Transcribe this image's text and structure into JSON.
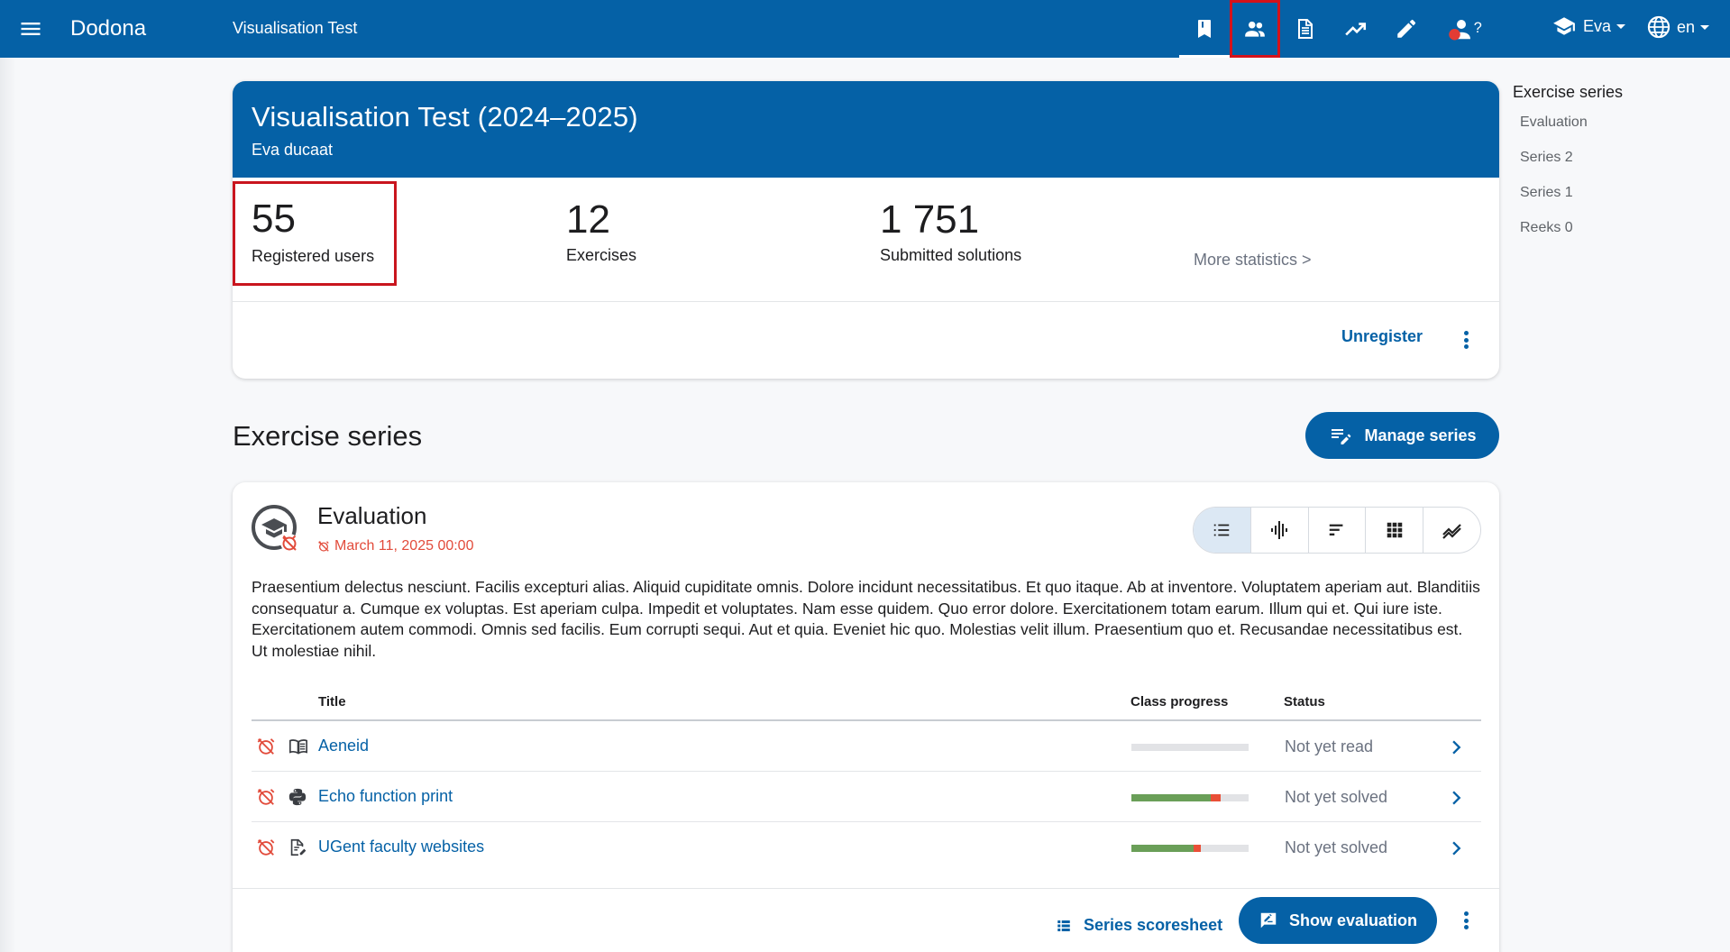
{
  "topbar": {
    "brand": "Dodona",
    "course_name": "Visualisation Test",
    "nav_icons": [
      "bookmark-icon",
      "users-icon",
      "file-document-icon",
      "trending-up-icon",
      "pencil-icon",
      "account-question-icon"
    ],
    "user_label": "Eva",
    "lang_label": "en",
    "highlight_color": "#d4121a"
  },
  "course": {
    "title": "Visualisation Test (2024–2025)",
    "teacher": "Eva ducaat",
    "stats": {
      "users_num": "55",
      "users_label": "Registered users",
      "exercises_num": "12",
      "exercises_label": "Exercises",
      "solutions_num": "1 751",
      "solutions_label": "Submitted solutions",
      "more": "More statistics >"
    },
    "unregister": "Unregister"
  },
  "toc": {
    "title": "Exercise series",
    "items": [
      "Evaluation",
      "Series 2",
      "Series 1",
      "Reeks 0"
    ]
  },
  "section": {
    "title": "Exercise series",
    "manage_label": "Manage series"
  },
  "series": {
    "name": "Evaluation",
    "deadline": "March 11, 2025 00:00",
    "description": "Praesentium delectus nesciunt. Facilis excepturi alias. Aliquid cupiditate omnis. Dolore incidunt necessitatibus. Et quo itaque. Ab at inventore. Voluptatem aperiam aut. Blanditiis consequatur a. Cumque ex voluptas. Est aperiam culpa. Impedit et voluptates. Nam esse quidem. Quo error dolore. Exercitationem totam earum. Illum qui et. Qui iure iste. Exercitationem autem commodi. Omnis sed facilis. Eum corrupti sequi. Aut et quia. Eveniet hic quo. Molestias velit illum. Praesentium quo et. Recusandae necessitatibus est. Ut molestiae nihil.",
    "columns": {
      "title": "Title",
      "progress": "Class progress",
      "status": "Status"
    },
    "exercises": [
      {
        "title": "Aeneid",
        "type_icon": "book-open-icon",
        "status": "Not yet read",
        "progress_solved": 0,
        "progress_wrong": 0
      },
      {
        "title": "Echo function print",
        "type_icon": "python-icon",
        "status": "Not yet solved",
        "progress_solved": 0.68,
        "progress_wrong": 0.08
      },
      {
        "title": "UGent faculty websites",
        "type_icon": "file-edit-icon",
        "status": "Not yet solved",
        "progress_solved": 0.53,
        "progress_wrong": 0.06
      }
    ],
    "scoresheet_label": "Series scoresheet",
    "show_eval_label": "Show evaluation",
    "colors": {
      "accent": "#0561a6",
      "deadline": "#e24b3b",
      "solved": "#6a9f58",
      "wrong": "#e94f37"
    }
  }
}
